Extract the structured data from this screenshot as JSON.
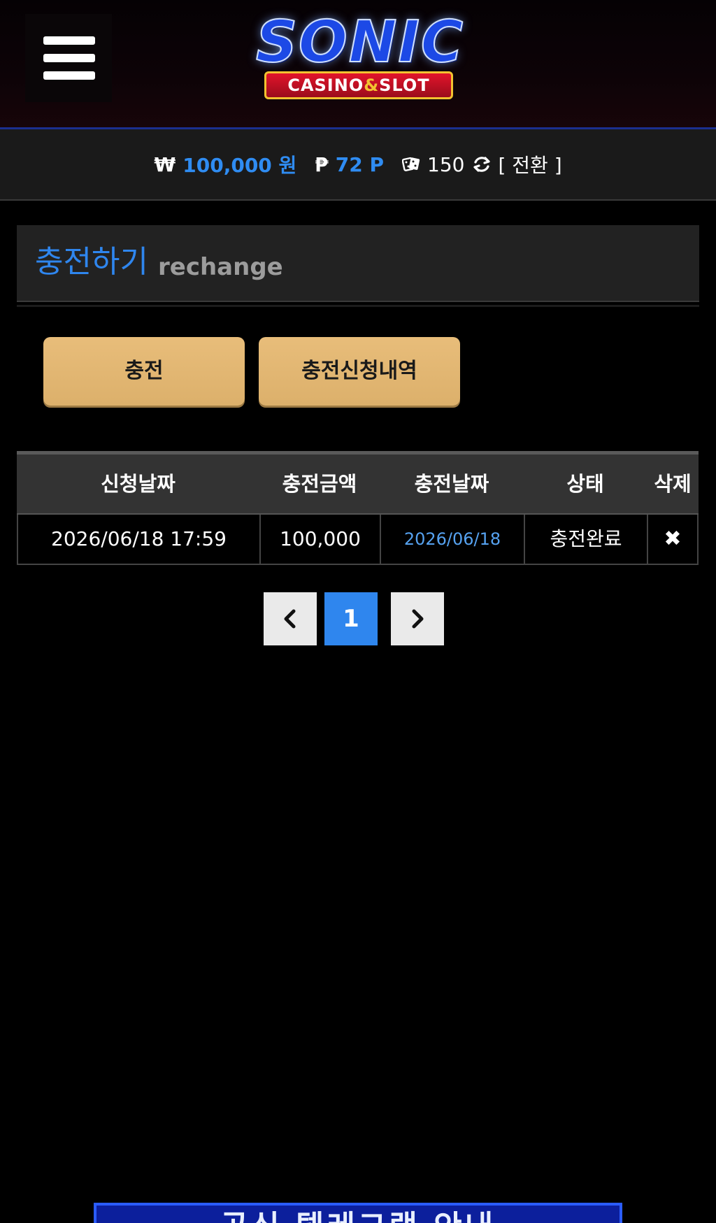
{
  "header": {
    "menu_icon": "hamburger-menu-icon",
    "logo": {
      "title": "SONIC",
      "subtitle_left": "CASINO",
      "subtitle_amp": "&",
      "subtitle_right": "SLOT"
    }
  },
  "balance": {
    "money_symbol": "₩",
    "money_value": "100,000 원",
    "point_symbol": "₱",
    "point_value": "72 P",
    "dice_icon": "dice-icon",
    "chips_value": "150",
    "refresh_icon": "refresh-icon",
    "switch_label": "[ 전환 ]"
  },
  "section": {
    "title_ko": "충전하기",
    "title_en": "rechange"
  },
  "tabs": {
    "charge": "충전",
    "history": "충전신청내역"
  },
  "table": {
    "headers": [
      "신청날짜",
      "충전금액",
      "충전날짜",
      "상태",
      "삭제"
    ],
    "rows": [
      {
        "request_date": "2026/06/18 17:59",
        "amount": "100,000",
        "charge_date": "2026/06/18",
        "status": "충전완료",
        "delete_icon": "✖"
      }
    ]
  },
  "pagination": {
    "prev_icon": "chevron-left-icon",
    "current_page": "1",
    "next_icon": "chevron-right-icon"
  },
  "banner": {
    "text": "공식 텔레그램 안내"
  },
  "colors": {
    "accent_blue": "#2f86ee",
    "button_gold": "#e3b673",
    "header_border": "#1b2f8f"
  }
}
